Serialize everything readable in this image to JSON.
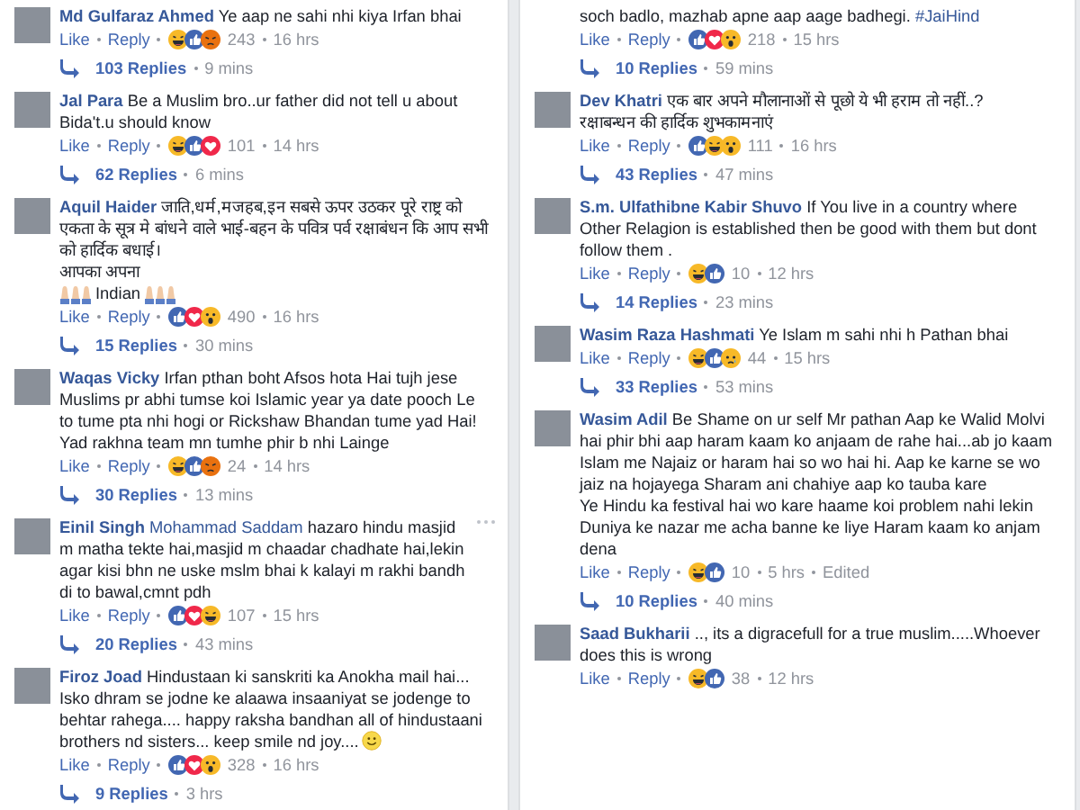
{
  "columns": [
    {
      "comments": [
        {
          "author": "Md Gulfaraz Ahmed",
          "text": "Ye aap ne sahi nhi kiya Irfan bhai",
          "actions": [
            "Like",
            "Reply"
          ],
          "reactions": [
            {
              "kind": "haha"
            },
            {
              "kind": "like"
            },
            {
              "kind": "angry"
            }
          ],
          "reaction_count": "243",
          "time": "16 hrs",
          "replies": {
            "label": "103 Replies",
            "time": "9 mins"
          }
        },
        {
          "author": "Jal Para",
          "text": "Be a Muslim bro..ur father did not tell u about Bida't.u should know",
          "actions": [
            "Like",
            "Reply"
          ],
          "reactions": [
            {
              "kind": "haha"
            },
            {
              "kind": "like"
            },
            {
              "kind": "love"
            }
          ],
          "reaction_count": "101",
          "time": "14 hrs",
          "replies": {
            "label": "62 Replies",
            "time": "6 mins"
          }
        },
        {
          "author": "Aquil Haider",
          "text": "जाति,धर्म,मजहब,इन सबसे ऊपर उठकर पूरे राष्ट्र को एकता के सूत्र मे बांधने वाले भाई-बहन के पवित्र पर्व रक्षाबंधन कि आप सभी को हार्दिक बधाई।\nआपका अपना",
          "extra_line": "Indian",
          "actions": [
            "Like",
            "Reply"
          ],
          "reactions": [
            {
              "kind": "like"
            },
            {
              "kind": "love"
            },
            {
              "kind": "wow"
            }
          ],
          "reaction_count": "490",
          "time": "16 hrs",
          "replies": {
            "label": "15 Replies",
            "time": "30 mins"
          }
        },
        {
          "author": "Waqas Vicky",
          "text": "Irfan pthan boht Afsos hota Hai tujh jese Muslims pr abhi tumse koi Islamic year ya date pooch Le to tume pta nhi hogi or Rickshaw Bhandan tume yad Hai! Yad rakhna team mn tumhe phir b nhi Lainge",
          "actions": [
            "Like",
            "Reply"
          ],
          "reactions": [
            {
              "kind": "haha"
            },
            {
              "kind": "like"
            },
            {
              "kind": "angry"
            }
          ],
          "reaction_count": "24",
          "time": "14 hrs",
          "replies": {
            "label": "30 Replies",
            "time": "13 mins"
          }
        },
        {
          "author": "Einil Singh",
          "mention": "Mohammad Saddam",
          "text": "hazaro hindu masjid m matha tekte hai,masjid m chaadar chadhate hai,lekin agar kisi bhn ne uske mslm bhai k kalayi m rakhi bandh di to bawal,cmnt pdh",
          "show_menu": true,
          "actions": [
            "Like",
            "Reply"
          ],
          "reactions": [
            {
              "kind": "like"
            },
            {
              "kind": "love"
            },
            {
              "kind": "haha"
            }
          ],
          "reaction_count": "107",
          "time": "15 hrs",
          "replies": {
            "label": "20 Replies",
            "time": "43 mins"
          }
        },
        {
          "author": "Firoz Joad",
          "text": "Hindustaan ki sanskriti ka Anokha mail hai... Isko dhram se jodne ke alaawa insaaniyat se jodenge to behtar rahega.... happy raksha bandhan all of hindustaani brothers nd sisters... keep smile nd joy....",
          "ends_with_smiley": true,
          "actions": [
            "Like",
            "Reply"
          ],
          "reactions": [
            {
              "kind": "like"
            },
            {
              "kind": "love"
            },
            {
              "kind": "wow"
            }
          ],
          "reaction_count": "328",
          "time": "16 hrs",
          "replies": {
            "label": "9 Replies",
            "time": "3 hrs"
          }
        }
      ]
    },
    {
      "comments": [
        {
          "text": "soch badlo, mazhab apne aap aage badhegi.",
          "hashtag": "#JaiHind",
          "actions": [
            "Like",
            "Reply"
          ],
          "reactions": [
            {
              "kind": "like"
            },
            {
              "kind": "love"
            },
            {
              "kind": "wow"
            }
          ],
          "reaction_count": "218",
          "time": "15 hrs",
          "replies": {
            "label": "10 Replies",
            "time": "59 mins"
          }
        },
        {
          "author": "Dev Khatri",
          "text": "एक बार अपने मौलानाओं से पूछो ये भी हराम तो नहीं..?\nरक्षाबन्धन की हार्दिक शुभकामनाएं",
          "actions": [
            "Like",
            "Reply"
          ],
          "reactions": [
            {
              "kind": "like"
            },
            {
              "kind": "haha"
            },
            {
              "kind": "wow"
            }
          ],
          "reaction_count": "111",
          "time": "16 hrs",
          "replies": {
            "label": "43 Replies",
            "time": "47 mins"
          }
        },
        {
          "author": "S.m. Ulfathibne Kabir Shuvo",
          "text": "If You live in a country where Other Relagion is established then be good with them but dont follow them .",
          "actions": [
            "Like",
            "Reply"
          ],
          "reactions": [
            {
              "kind": "haha"
            },
            {
              "kind": "like"
            }
          ],
          "reaction_count": "10",
          "time": "12 hrs",
          "replies": {
            "label": "14 Replies",
            "time": "23 mins"
          }
        },
        {
          "author": "Wasim Raza Hashmati",
          "text": "Ye Islam m sahi nhi h Pathan bhai",
          "actions": [
            "Like",
            "Reply"
          ],
          "reactions": [
            {
              "kind": "haha"
            },
            {
              "kind": "like"
            },
            {
              "kind": "sad"
            }
          ],
          "reaction_count": "44",
          "time": "15 hrs",
          "replies": {
            "label": "33 Replies",
            "time": "53 mins"
          }
        },
        {
          "author": "Wasim Adil",
          "text": "Be Shame on ur self Mr pathan Aap ke Walid Molvi hai phir bhi aap haram kaam ko anjaam de rahe hai...ab jo kaam Islam me Najaiz or haram hai so wo hai hi. Aap ke karne se wo jaiz na hojayega Sharam ani chahiye aap ko tauba kare\nYe Hindu ka festival hai wo kare haame koi problem nahi lekin Duniya ke nazar me acha banne ke liye Haram kaam ko anjam dena",
          "actions": [
            "Like",
            "Reply"
          ],
          "reactions": [
            {
              "kind": "haha"
            },
            {
              "kind": "like"
            }
          ],
          "reaction_count": "10",
          "time": "5 hrs",
          "edited": "Edited",
          "replies": {
            "label": "10 Replies",
            "time": "40 mins"
          }
        },
        {
          "author": "Saad Bukharii",
          "text": ".., its a digracefull for a true muslim.....Whoever does this is wrong",
          "actions": [
            "Like",
            "Reply"
          ],
          "reactions": [
            {
              "kind": "haha"
            },
            {
              "kind": "like"
            }
          ],
          "reaction_count": "38",
          "time": "12 hrs"
        }
      ]
    }
  ]
}
